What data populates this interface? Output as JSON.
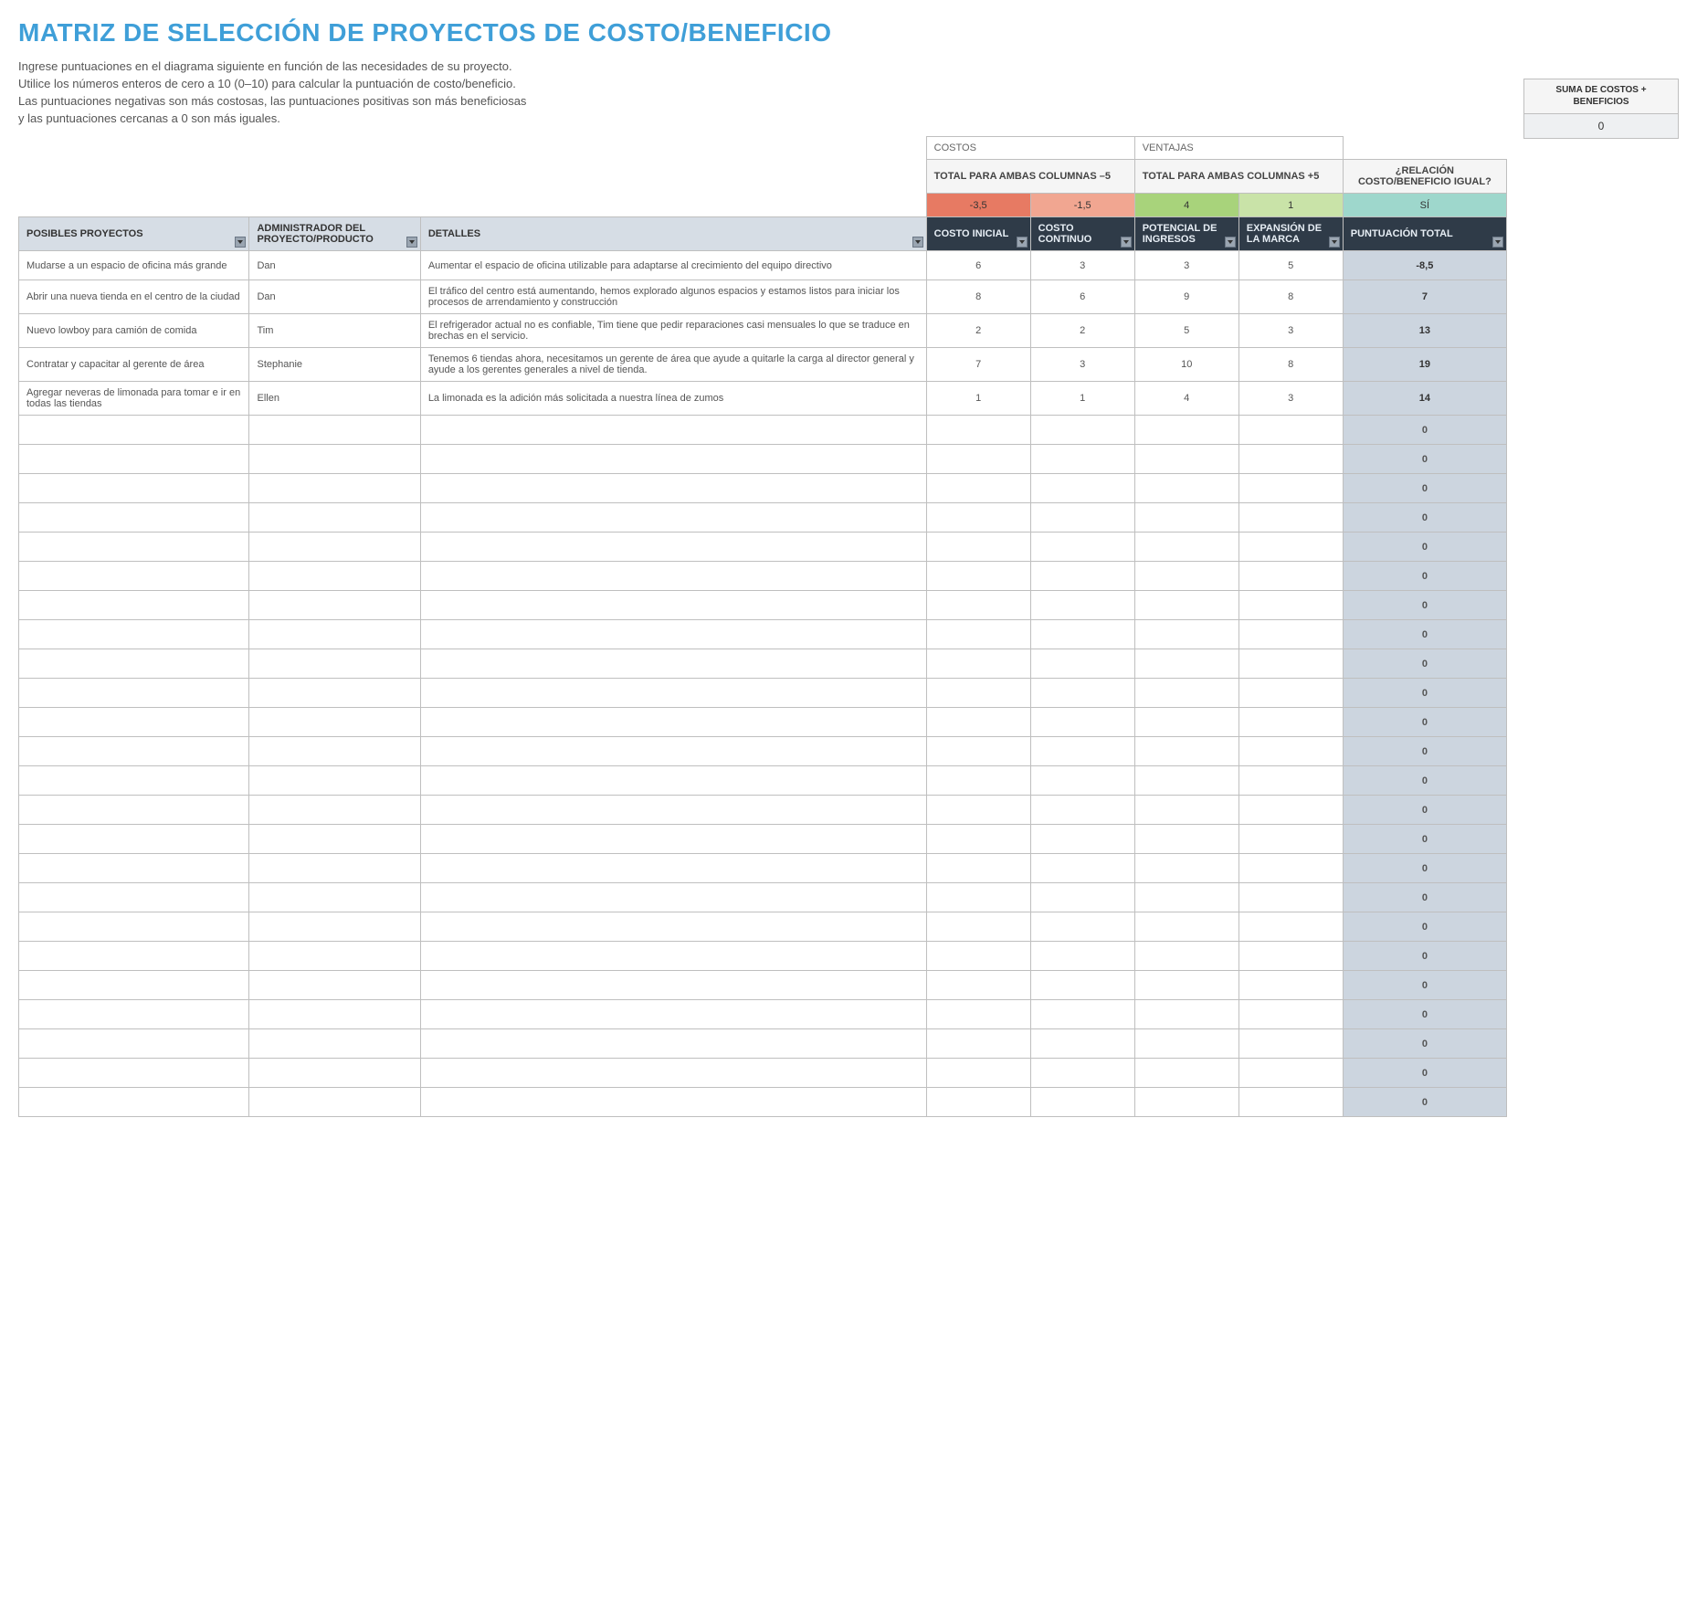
{
  "title": "MATRIZ DE SELECCIÓN DE PROYECTOS DE COSTO/BENEFICIO",
  "instructions": [
    "Ingrese puntuaciones en el diagrama siguiente en función de las necesidades de su proyecto.",
    "Utilice los números enteros de cero a 10 (0–10) para calcular la puntuación de costo/beneficio.",
    "Las puntuaciones negativas son más costosas, las puntuaciones positivas son más beneficiosas",
    "y las puntuaciones cercanas a 0 son más iguales."
  ],
  "sections": {
    "costs_label": "COSTOS",
    "benefits_label": "VENTAJAS",
    "costs_sub": "TOTAL PARA AMBAS COLUMNAS –5",
    "benefits_sub": "TOTAL PARA AMBAS COLUMNAS +5",
    "relation_label": "¿RELACIÓN COSTO/BENEFICIO IGUAL?",
    "costs_vals": [
      "-3,5",
      "-1,5"
    ],
    "benefits_vals": [
      "4",
      "1"
    ],
    "relation_val": "SÍ"
  },
  "sum_box": {
    "label": "SUMA DE COSTOS + BENEFICIOS",
    "value": "0"
  },
  "columns": {
    "projects": "POSIBLES PROYECTOS",
    "admin": "ADMINISTRADOR DEL PROYECTO/PRODUCTO",
    "details": "DETALLES",
    "cost_initial": "COSTO INICIAL",
    "cost_ongoing": "COSTO CONTINUO",
    "rev_potential": "POTENCIAL DE INGRESOS",
    "brand_exp": "EXPANSIÓN DE LA MARCA",
    "total": "PUNTUACIÓN TOTAL"
  },
  "rows": [
    {
      "project": "Mudarse a un espacio de oficina más grande",
      "admin": "Dan",
      "details": "Aumentar el espacio de oficina utilizable para adaptarse al crecimiento del equipo directivo",
      "ci": "6",
      "cc": "3",
      "rp": "3",
      "be": "5",
      "total": "-8,5"
    },
    {
      "project": "Abrir una nueva tienda en el centro de la ciudad",
      "admin": "Dan",
      "details": "El tráfico del centro está aumentando, hemos explorado algunos espacios y estamos listos para iniciar los procesos de arrendamiento y construcción",
      "ci": "8",
      "cc": "6",
      "rp": "9",
      "be": "8",
      "total": "7"
    },
    {
      "project": "Nuevo lowboy para camión de comida",
      "admin": "Tim",
      "details": "El refrigerador actual no es confiable, Tim tiene que pedir reparaciones casi mensuales lo que se traduce en brechas en el servicio.",
      "ci": "2",
      "cc": "2",
      "rp": "5",
      "be": "3",
      "total": "13"
    },
    {
      "project": "Contratar y capacitar al gerente de área",
      "admin": "Stephanie",
      "details": "Tenemos 6 tiendas ahora, necesitamos un gerente de área que ayude a quitarle la carga al director general y ayude a los gerentes generales a nivel de tienda.",
      "ci": "7",
      "cc": "3",
      "rp": "10",
      "be": "8",
      "total": "19"
    },
    {
      "project": "Agregar neveras de limonada para tomar e ir en todas las tiendas",
      "admin": "Ellen",
      "details": "La limonada es la adición más solicitada a nuestra línea de zumos",
      "ci": "1",
      "cc": "1",
      "rp": "4",
      "be": "3",
      "total": "14"
    }
  ],
  "empty_row_count": 24,
  "empty_total": "0"
}
